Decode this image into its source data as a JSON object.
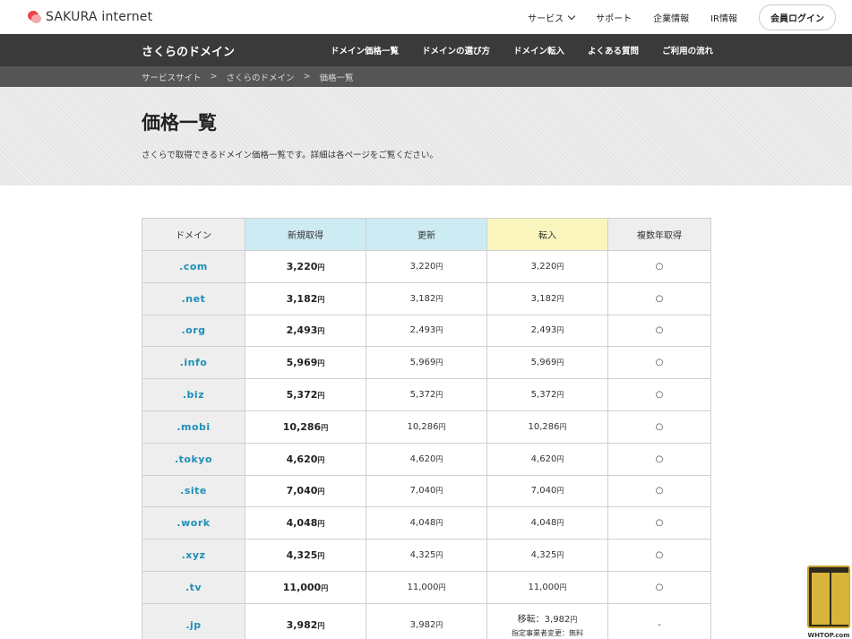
{
  "header": {
    "logo_text": "SAKURA internet",
    "nav": [
      {
        "label": "サービス",
        "dropdown": true
      },
      {
        "label": "サポート"
      },
      {
        "label": "企業情報"
      },
      {
        "label": "IR情報"
      }
    ],
    "login_label": "会員ログイン"
  },
  "subnav": {
    "title": "さくらのドメイン",
    "links": [
      "ドメイン価格一覧",
      "ドメインの選び方",
      "ドメイン転入",
      "よくある質問",
      "ご利用の流れ"
    ]
  },
  "breadcrumb": {
    "items": [
      "サービスサイト",
      "さくらのドメイン",
      "価格一覧"
    ],
    "sep": ">"
  },
  "hero": {
    "title": "価格一覧",
    "description": "さくらで取得できるドメイン価格一覧です。詳細は各ページをご覧ください。"
  },
  "table": {
    "headers": [
      "ドメイン",
      "新規取得",
      "更新",
      "転入",
      "複数年取得"
    ],
    "yen": "円",
    "rows": [
      {
        "domain": ".com",
        "new": "3,220",
        "renew": "3,220",
        "transfer": "3,220",
        "multi": "○"
      },
      {
        "domain": ".net",
        "new": "3,182",
        "renew": "3,182",
        "transfer": "3,182",
        "multi": "○"
      },
      {
        "domain": ".org",
        "new": "2,493",
        "renew": "2,493",
        "transfer": "2,493",
        "multi": "○"
      },
      {
        "domain": ".info",
        "new": "5,969",
        "renew": "5,969",
        "transfer": "5,969",
        "multi": "○"
      },
      {
        "domain": ".biz",
        "new": "5,372",
        "renew": "5,372",
        "transfer": "5,372",
        "multi": "○"
      },
      {
        "domain": ".mobi",
        "new": "10,286",
        "renew": "10,286",
        "transfer": "10,286",
        "multi": "○"
      },
      {
        "domain": ".tokyo",
        "new": "4,620",
        "renew": "4,620",
        "transfer": "4,620",
        "multi": "○"
      },
      {
        "domain": ".site",
        "new": "7,040",
        "renew": "7,040",
        "transfer": "7,040",
        "multi": "○"
      },
      {
        "domain": ".work",
        "new": "4,048",
        "renew": "4,048",
        "transfer": "4,048",
        "multi": "○"
      },
      {
        "domain": ".xyz",
        "new": "4,325",
        "renew": "4,325",
        "transfer": "4,325",
        "multi": "○"
      },
      {
        "domain": ".tv",
        "new": "11,000",
        "renew": "11,000",
        "transfer": "11,000",
        "multi": "○"
      }
    ],
    "jp_row": {
      "domain": ".jp",
      "new": "3,982",
      "renew": "3,982",
      "transfer_prefix": "移転：",
      "transfer": "3,982",
      "transfer_note": "指定事業者変更：無料",
      "multi": "-"
    }
  },
  "watermark": {
    "label": "WHTOP.com"
  }
}
